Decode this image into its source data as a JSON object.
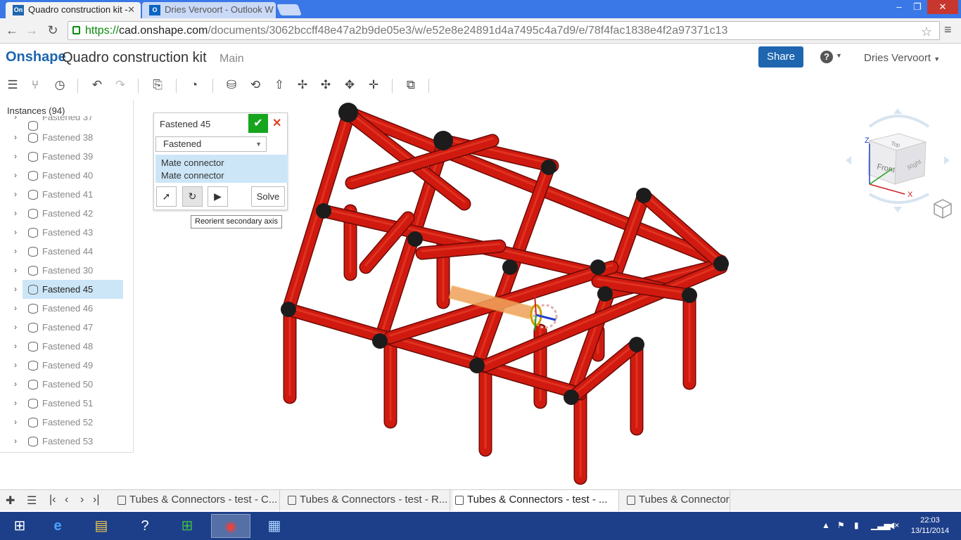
{
  "browser": {
    "tabs": [
      {
        "label": "Quadro construction kit -",
        "favicon": "On",
        "active": true
      },
      {
        "label": "Dries Vervoort - Outlook W",
        "favicon": "O",
        "active": false
      }
    ],
    "url_scheme": "https://",
    "url_host": "cad.onshape.com",
    "url_path": "/documents/3062bccff48e47a2b9de05e3/w/e52e8e24891d4a7495c4a7d9/e/78f4fac1838e4f2a97371c13"
  },
  "header": {
    "logo": "Onshape",
    "title": "Quadro construction kit",
    "branch": "Main",
    "share_label": "Share",
    "help_label": "?",
    "user": "Dries Vervoort"
  },
  "instances": {
    "title": "Instances (94)",
    "items": [
      {
        "label": "Fastened 37"
      },
      {
        "label": "Fastened 38"
      },
      {
        "label": "Fastened 39"
      },
      {
        "label": "Fastened 40"
      },
      {
        "label": "Fastened 41"
      },
      {
        "label": "Fastened 42"
      },
      {
        "label": "Fastened 43"
      },
      {
        "label": "Fastened 44"
      },
      {
        "label": "Fastened 30"
      },
      {
        "label": "Fastened 45",
        "selected": true
      },
      {
        "label": "Fastened 46"
      },
      {
        "label": "Fastened 47"
      },
      {
        "label": "Fastened 48"
      },
      {
        "label": "Fastened 49"
      },
      {
        "label": "Fastened 50"
      },
      {
        "label": "Fastened 51"
      },
      {
        "label": "Fastened 52"
      },
      {
        "label": "Fastened 53"
      }
    ]
  },
  "mate_dialog": {
    "title": "Fastened 45",
    "type_value": "Fastened",
    "connectors": [
      "Mate connector",
      "Mate connector"
    ],
    "solve_label": "Solve",
    "tooltip": "Reorient secondary axis"
  },
  "viewcube": {
    "faces": [
      "Top",
      "Front",
      "Right"
    ],
    "axes": [
      "Z",
      "X"
    ]
  },
  "bottom_tabs": [
    {
      "label": "Tubes & Connectors - test - C...",
      "active": false
    },
    {
      "label": "Tubes & Connectors - test - R...",
      "active": false
    },
    {
      "label": "Tubes & Connectors - test - ...",
      "active": true
    },
    {
      "label": "Tubes & Connector",
      "active": false
    }
  ],
  "taskbar": {
    "time": "22:03",
    "date": "13/11/2014"
  },
  "colors": {
    "tube": "#d01a10",
    "connector": "#1c1c1c",
    "accent": "#1e66b0",
    "selection": "#cce6f7"
  }
}
